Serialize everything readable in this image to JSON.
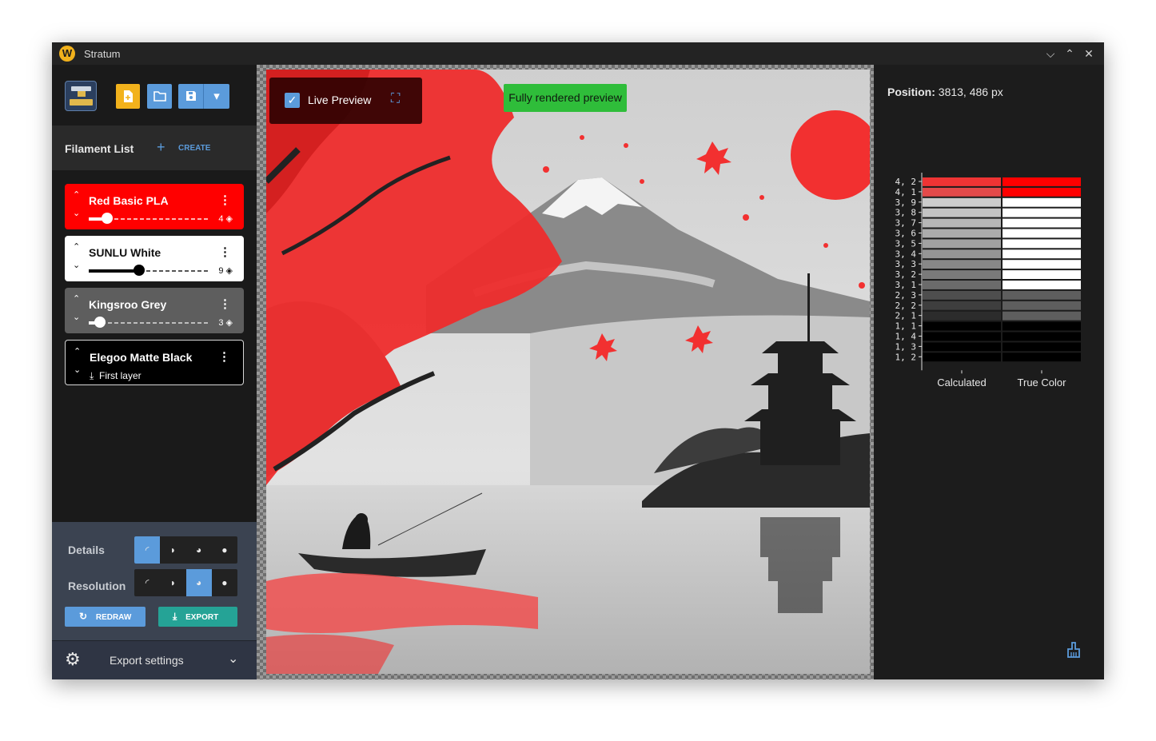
{
  "app": {
    "title": "Stratum",
    "logo_letter": "W"
  },
  "window_controls": {
    "minimize": "⌵",
    "maximize": "⌃",
    "close": "✕"
  },
  "toolbar": {
    "new_icon": "new-file-icon",
    "open_icon": "folder-icon",
    "save_icon": "save-icon",
    "dropdown_icon": "▾"
  },
  "filament_list": {
    "title": "Filament List",
    "create_label": "CREATE",
    "items": [
      {
        "name": "Red Basic PLA",
        "layers": "4",
        "slider_fraction": 0.15,
        "bg": "#ff0000",
        "fg": "#ffffff"
      },
      {
        "name": "SUNLU White",
        "layers": "9",
        "slider_fraction": 0.42,
        "bg": "#ffffff",
        "fg": "#111111"
      },
      {
        "name": "Kingsroo Grey",
        "layers": "3",
        "slider_fraction": 0.09,
        "bg": "#5e5e5e",
        "fg": "#ffffff"
      },
      {
        "name": "Elegoo Matte Black",
        "sub_label": "First layer",
        "bg": "#000000",
        "fg": "#ffffff"
      }
    ]
  },
  "controls": {
    "details_label": "Details",
    "details_selected": 0,
    "resolution_label": "Resolution",
    "resolution_selected": 2,
    "redraw_label": "REDRAW",
    "export_label": "EXPORT"
  },
  "export_settings": {
    "label": "Export settings"
  },
  "preview": {
    "live_preview_label": "Live Preview",
    "live_preview_checked": true,
    "status_badge": "Fully rendered preview"
  },
  "info": {
    "position_label": "Position:",
    "position_value": "3813, 486 px"
  },
  "chart_data": {
    "type": "table",
    "columns": [
      "Calculated",
      "True Color"
    ],
    "rows": [
      {
        "label": "4, 2",
        "calculated": "#ee3434",
        "true_color": "#ff0000"
      },
      {
        "label": "4, 1",
        "calculated": "#e34a4a",
        "true_color": "#ff0000"
      },
      {
        "label": "3, 9",
        "calculated": "#cccccc",
        "true_color": "#ffffff"
      },
      {
        "label": "3, 8",
        "calculated": "#c3c3c3",
        "true_color": "#ffffff"
      },
      {
        "label": "3, 7",
        "calculated": "#b7b7b7",
        "true_color": "#ffffff"
      },
      {
        "label": "3, 6",
        "calculated": "#acacac",
        "true_color": "#ffffff"
      },
      {
        "label": "3, 5",
        "calculated": "#a1a1a1",
        "true_color": "#ffffff"
      },
      {
        "label": "3, 4",
        "calculated": "#959595",
        "true_color": "#ffffff"
      },
      {
        "label": "3, 3",
        "calculated": "#888888",
        "true_color": "#ffffff"
      },
      {
        "label": "3, 2",
        "calculated": "#7a7a7a",
        "true_color": "#ffffff"
      },
      {
        "label": "3, 1",
        "calculated": "#6b6b6b",
        "true_color": "#ffffff"
      },
      {
        "label": "2, 3",
        "calculated": "#4e4e4e",
        "true_color": "#5e5e5e"
      },
      {
        "label": "2, 2",
        "calculated": "#3e3e3e",
        "true_color": "#5e5e5e"
      },
      {
        "label": "2, 1",
        "calculated": "#2c2c2c",
        "true_color": "#5e5e5e"
      },
      {
        "label": "1, 1",
        "calculated": "#000000",
        "true_color": "#000000"
      },
      {
        "label": "1, 4",
        "calculated": "#000000",
        "true_color": "#000000"
      },
      {
        "label": "1, 3",
        "calculated": "#000000",
        "true_color": "#000000"
      },
      {
        "label": "1, 2",
        "calculated": "#000000",
        "true_color": "#000000"
      }
    ]
  },
  "colors": {
    "accent": "#5b9bdb",
    "teal": "#25a396",
    "yellow": "#f2b21c",
    "status_green": "#2fbd3a"
  }
}
